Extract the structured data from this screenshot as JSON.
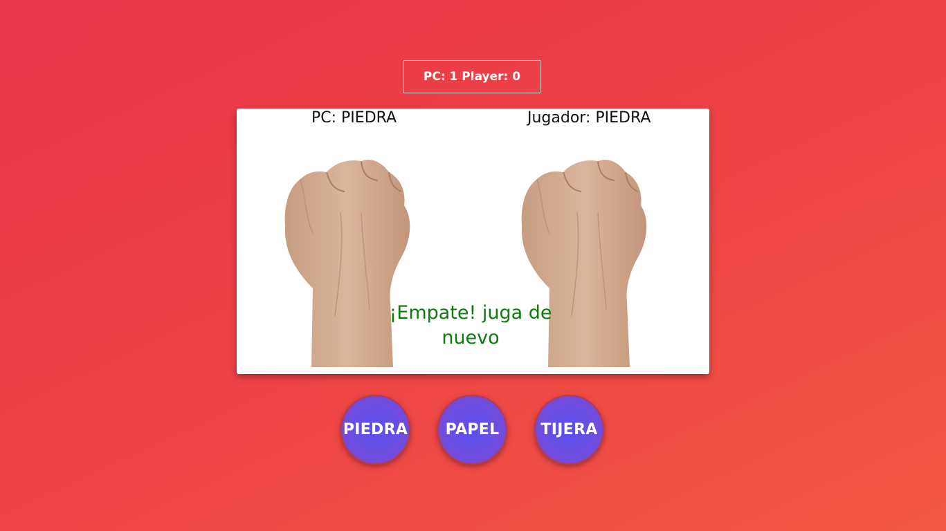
{
  "scoreboard": {
    "text": "PC: 1 Player: 0"
  },
  "board": {
    "pc_choice": "PC: PIEDRA",
    "player_choice": "Jugador: PIEDRA",
    "result_line1": "¡Empate! juga de",
    "result_line2": "nuevo",
    "result_color": "#0e7a0e"
  },
  "buttons": {
    "rock": "PIEDRA",
    "paper": "PAPEL",
    "scissors": "TIJERA"
  },
  "colors": {
    "background_start": "#ea3748",
    "background_end": "#f25842",
    "button_fill": "#6d4de0"
  }
}
